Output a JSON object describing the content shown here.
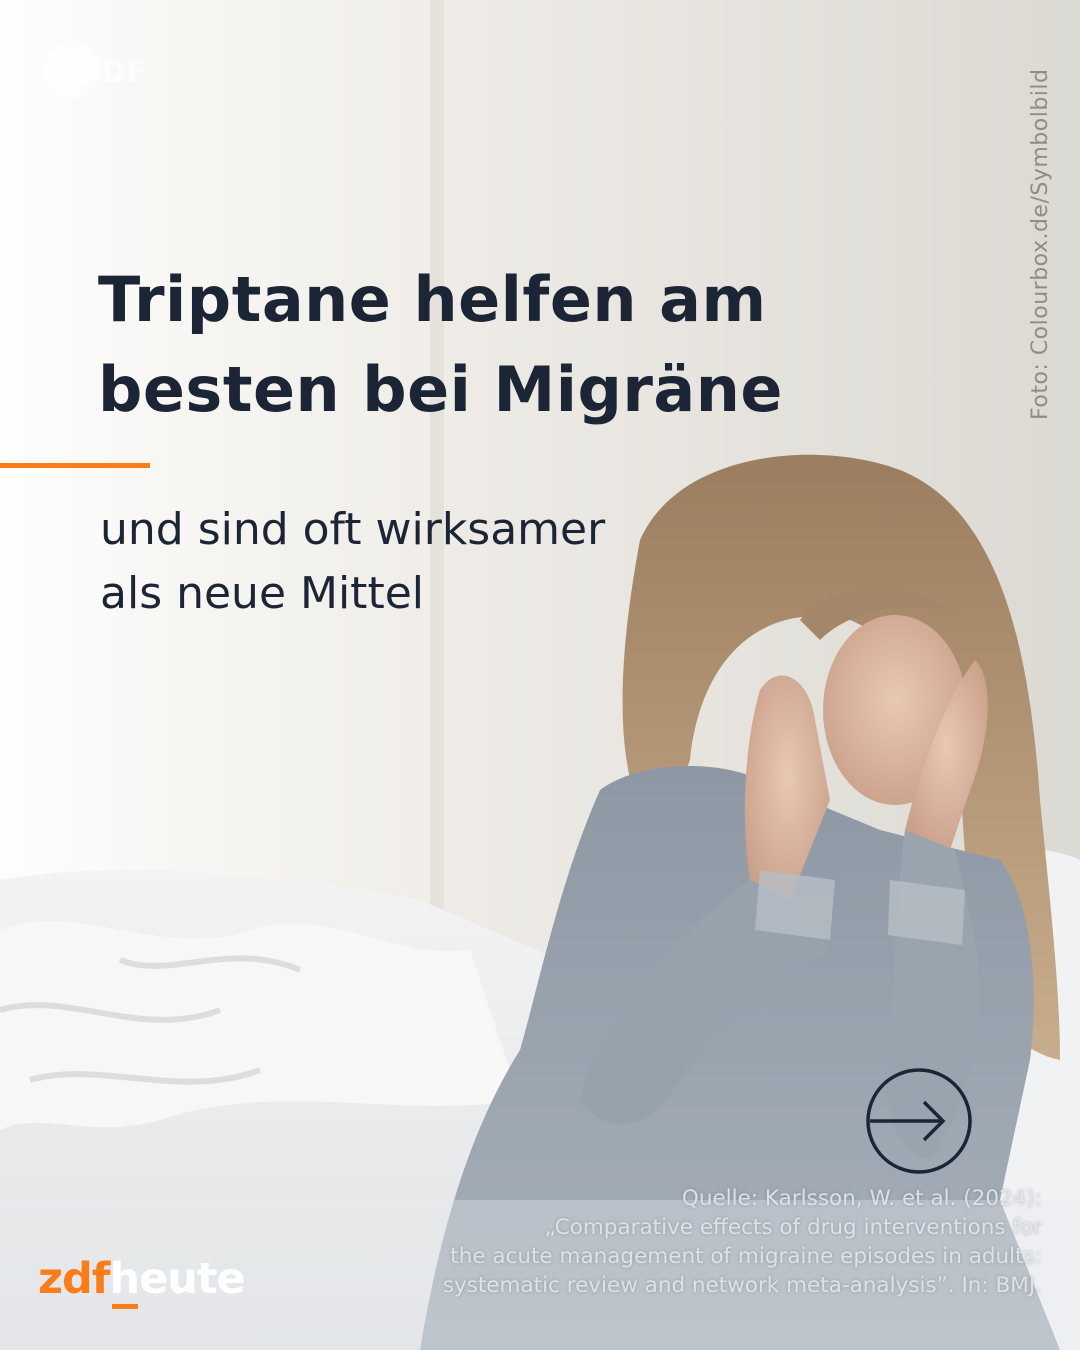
{
  "photo": {
    "description_icon": "woman-with-headache-photo-icon"
  },
  "top_logo": {
    "text": "ZDF"
  },
  "headline": {
    "line1": "Triptane helfen am",
    "line2": "besten bei Migräne"
  },
  "subline": {
    "line1": "und sind oft wirksamer",
    "line2": "als neue Mittel"
  },
  "photo_credit": "Foto: Colourbox.de/Symbolbild",
  "next_button": {
    "icon": "arrow-right-circle-icon"
  },
  "source": {
    "line1": "Quelle: Karlsson, W. et al. (2024):",
    "line2": "„Comparative effects of drug interventions for",
    "line3": "the acute management of migraine episodes in adults:",
    "line4": "systematic review and network meta-analysis”. In: BMJ."
  },
  "brand": {
    "part1": "zdf",
    "part2": "heute"
  },
  "colors": {
    "accent": "#fa7d19",
    "headline_text": "#1c2535",
    "background": "#e9e6e1"
  }
}
